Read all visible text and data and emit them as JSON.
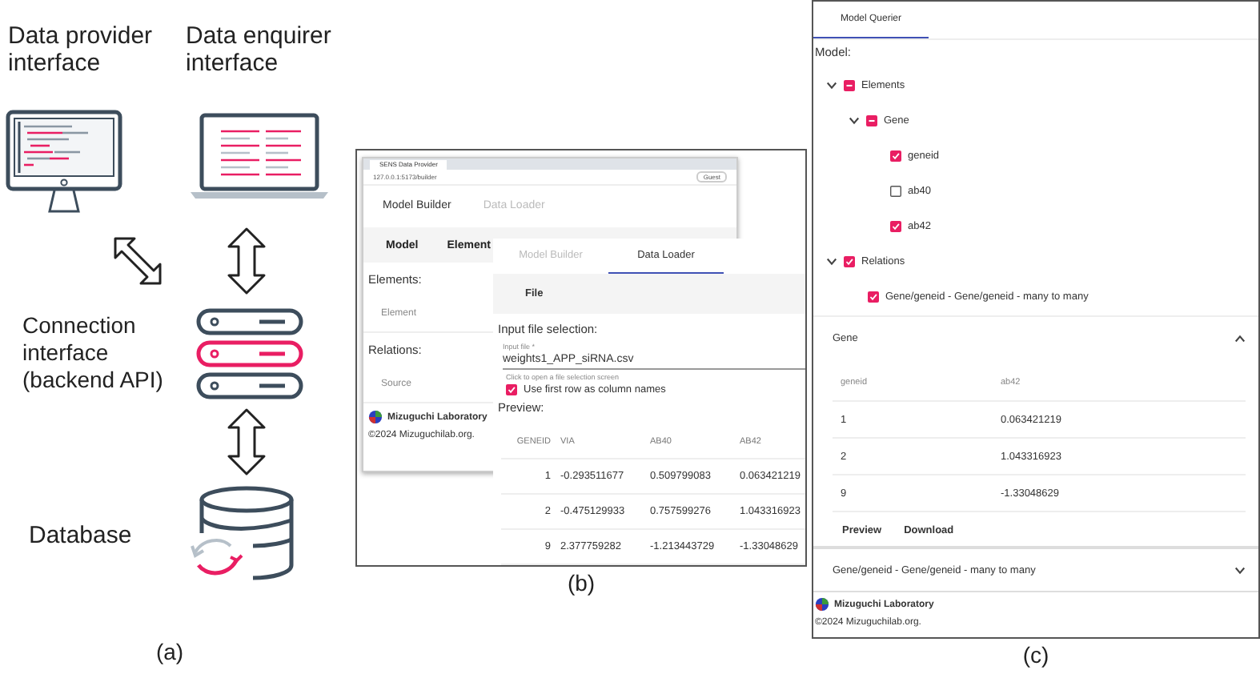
{
  "panel_a": {
    "provider_label": "Data provider interface",
    "enquirer_label": "Data enquirer interface",
    "connection_label": "Connection interface (backend API)",
    "database_label": "Database",
    "caption": "(a)"
  },
  "panel_b": {
    "back_window": {
      "browser_tab": "SENS Data Provider",
      "url": "127.0.0.1:5173/builder",
      "profile": "Guest",
      "tabs": [
        {
          "label": "Model Builder",
          "selected": true
        },
        {
          "label": "Data Loader",
          "selected": false
        }
      ],
      "subtabs": [
        {
          "label": "Model",
          "selected": false
        },
        {
          "label": "Element",
          "selected": false
        }
      ],
      "sections": [
        {
          "heading": "Elements:",
          "item": "Element"
        },
        {
          "heading": "Relations:",
          "item": "Source"
        }
      ],
      "footer": {
        "lab": "Mizuguchi Laboratory",
        "copyright": "©2024 Mizuguchilab.org."
      }
    },
    "front_window": {
      "tabs": [
        {
          "label": "Model Builder",
          "selected": false
        },
        {
          "label": "Data Loader",
          "selected": true
        }
      ],
      "file_tab": "File",
      "heading": "Input file selection:",
      "input": {
        "label": "Input file *",
        "value": "weights1_APP_siRNA.csv",
        "helper": "Click to open a file selection screen"
      },
      "checkbox": {
        "label": "Use first row as column names",
        "checked": true
      },
      "preview_heading": "Preview:",
      "table": {
        "columns": [
          "GENEID",
          "VIA",
          "AB40",
          "AB42"
        ],
        "rows": [
          [
            "1",
            "-0.293511677",
            "0.509799083",
            "0.063421219"
          ],
          [
            "2",
            "-0.475129933",
            "0.757599276",
            "1.043316923"
          ],
          [
            "9",
            "2.377759282",
            "-1.213443729",
            "-1.33048629"
          ]
        ]
      }
    },
    "caption": "(b)"
  },
  "panel_c": {
    "tabs": [
      {
        "label": "Model Querier",
        "selected": true
      }
    ],
    "heading": "Model:",
    "tree": [
      {
        "label": "Elements",
        "checked": false,
        "indeterminate": true,
        "expanded": true,
        "children": [
          {
            "label": "Gene",
            "checked": false,
            "indeterminate": true,
            "expanded": true,
            "children": [
              {
                "label": "geneid",
                "checked": true,
                "indeterminate": false
              },
              {
                "label": "ab40",
                "checked": false,
                "indeterminate": false
              },
              {
                "label": "ab42",
                "checked": true,
                "indeterminate": false
              }
            ]
          }
        ]
      },
      {
        "label": "Relations",
        "checked": true,
        "indeterminate": false,
        "expanded": true,
        "children": [
          {
            "label": "Gene/geneid - Gene/geneid - many to many",
            "checked": true,
            "indeterminate": false
          }
        ]
      }
    ],
    "accordions": [
      {
        "title": "Gene",
        "expanded": true,
        "table": {
          "columns": [
            "geneid",
            "ab42"
          ],
          "rows": [
            [
              "1",
              "0.063421219"
            ],
            [
              "2",
              "1.043316923"
            ],
            [
              "9",
              "-1.33048629"
            ]
          ]
        },
        "actions": [
          "Preview",
          "Download"
        ]
      },
      {
        "title": "Gene/geneid - Gene/geneid - many to many",
        "expanded": false
      }
    ],
    "footer": {
      "lab": "Mizuguchi Laboratory",
      "copyright": "©2024 Mizuguchilab.org."
    },
    "caption": "(c)"
  }
}
